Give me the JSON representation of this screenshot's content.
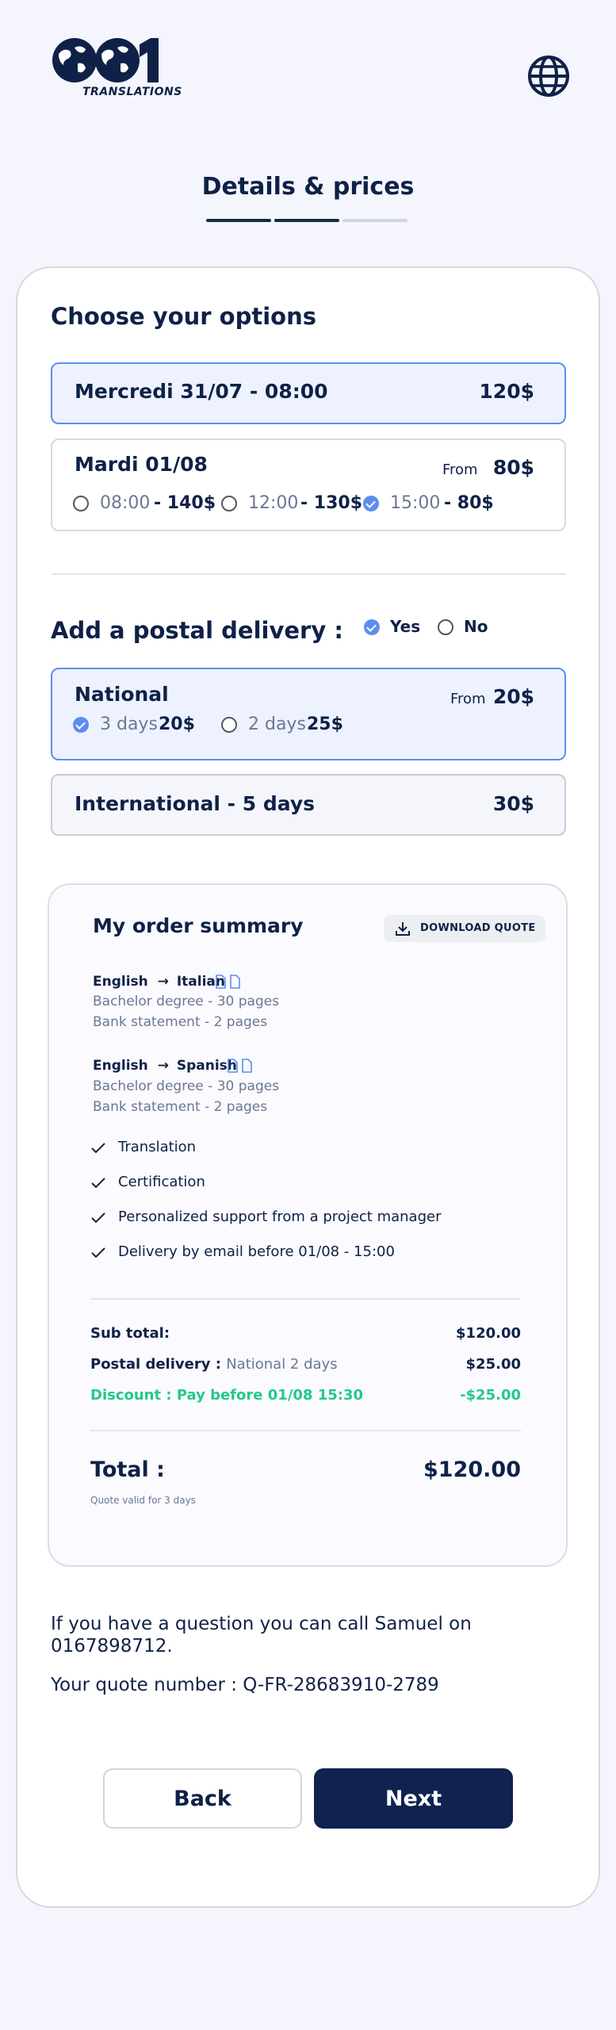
{
  "header": {
    "logo_text": "TRANSLATIONS",
    "step_title": "Details & prices"
  },
  "options": {
    "title": "Choose your options",
    "primary": {
      "label": "Mercredi 31/07 - 08:00",
      "price": "120$"
    },
    "secondary": {
      "label": "Mardi 01/08",
      "from_label": "From",
      "price": "80$",
      "slots": [
        {
          "time": "08:00",
          "price": "- 140$",
          "checked": false
        },
        {
          "time": "12:00",
          "price": "- 130$",
          "checked": false
        },
        {
          "time": "15:00",
          "price": "- 80$",
          "checked": true
        }
      ]
    }
  },
  "postal": {
    "title": "Add a postal delivery :",
    "yes_label": "Yes",
    "no_label": "No",
    "national": {
      "label": "National",
      "from_label": "From",
      "price": "20$",
      "options": [
        {
          "days": "3 days",
          "price": "20$",
          "checked": true
        },
        {
          "days": "2 days",
          "price": "25$",
          "checked": false
        }
      ]
    },
    "international": {
      "label": "International - 5 days",
      "price": "30$"
    }
  },
  "summary": {
    "title": "My order summary",
    "download_label": "DOWNLOAD QUOTE",
    "pairs": [
      {
        "source": "English",
        "arrow": "→",
        "target": "Italian",
        "docs": [
          "Bachelor degree -  30 pages",
          "Bank statement - 2 pages"
        ]
      },
      {
        "source": "English",
        "arrow": "→",
        "target": "Spanish",
        "docs": [
          "Bachelor degree -  30 pages",
          "Bank statement - 2 pages"
        ]
      }
    ],
    "features": [
      "Translation",
      "Certification",
      "Personalized support from a project manager",
      "Delivery by email before 01/08 - 15:00"
    ],
    "subtotal_label": "Sub total:",
    "subtotal_value": "$120.00",
    "postal_label": "Postal delivery :",
    "postal_detail": "National 2 days",
    "postal_value": "$25.00",
    "discount_label": "Discount : Pay before 01/08 15:30",
    "discount_value": "-$25.00",
    "total_label": "Total :",
    "total_value": "$120.00",
    "valid_note": "Quote valid for 3 days"
  },
  "contact": {
    "question": "If you have a question you can call Samuel on 0167898712.",
    "quote_number": "Your quote number : Q-FR-28683910-2789"
  },
  "nav": {
    "back_label": "Back",
    "next_label": "Next"
  },
  "colors": {
    "navy": "#0f2147",
    "accent": "#5b8ef0",
    "discount": "#22c98a",
    "background": "#f4f5fd"
  }
}
